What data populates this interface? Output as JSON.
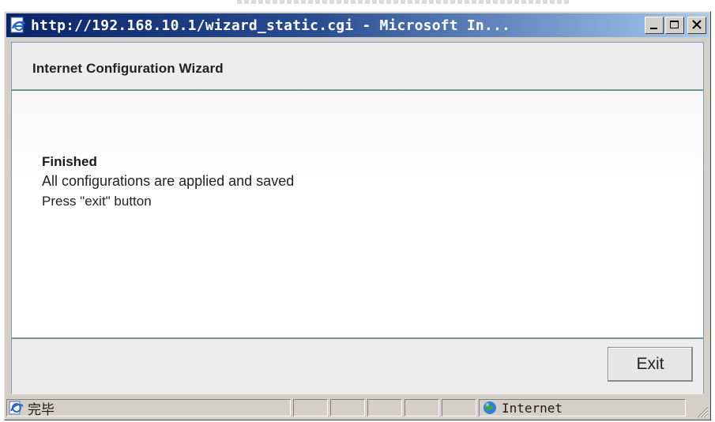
{
  "window": {
    "title": "http://192.168.10.1/wizard_static.cgi - Microsoft In...",
    "buttons": {
      "minimize": "_",
      "maximize": "□",
      "close": "X"
    }
  },
  "wizard": {
    "title": "Internet Configuration Wizard",
    "heading": "Finished",
    "message_line1": "All configurations are applied and saved",
    "message_line2": "Press \"exit\" button",
    "exit_label": "Exit"
  },
  "statusbar": {
    "status_text": "完毕",
    "zone_label": "Internet"
  },
  "colors": {
    "titlebar_start": "#0a246a",
    "titlebar_end": "#a6caf0",
    "chrome": "#d4d0c8",
    "header_bg": "#ededed",
    "divider": "#6f9a9a"
  }
}
